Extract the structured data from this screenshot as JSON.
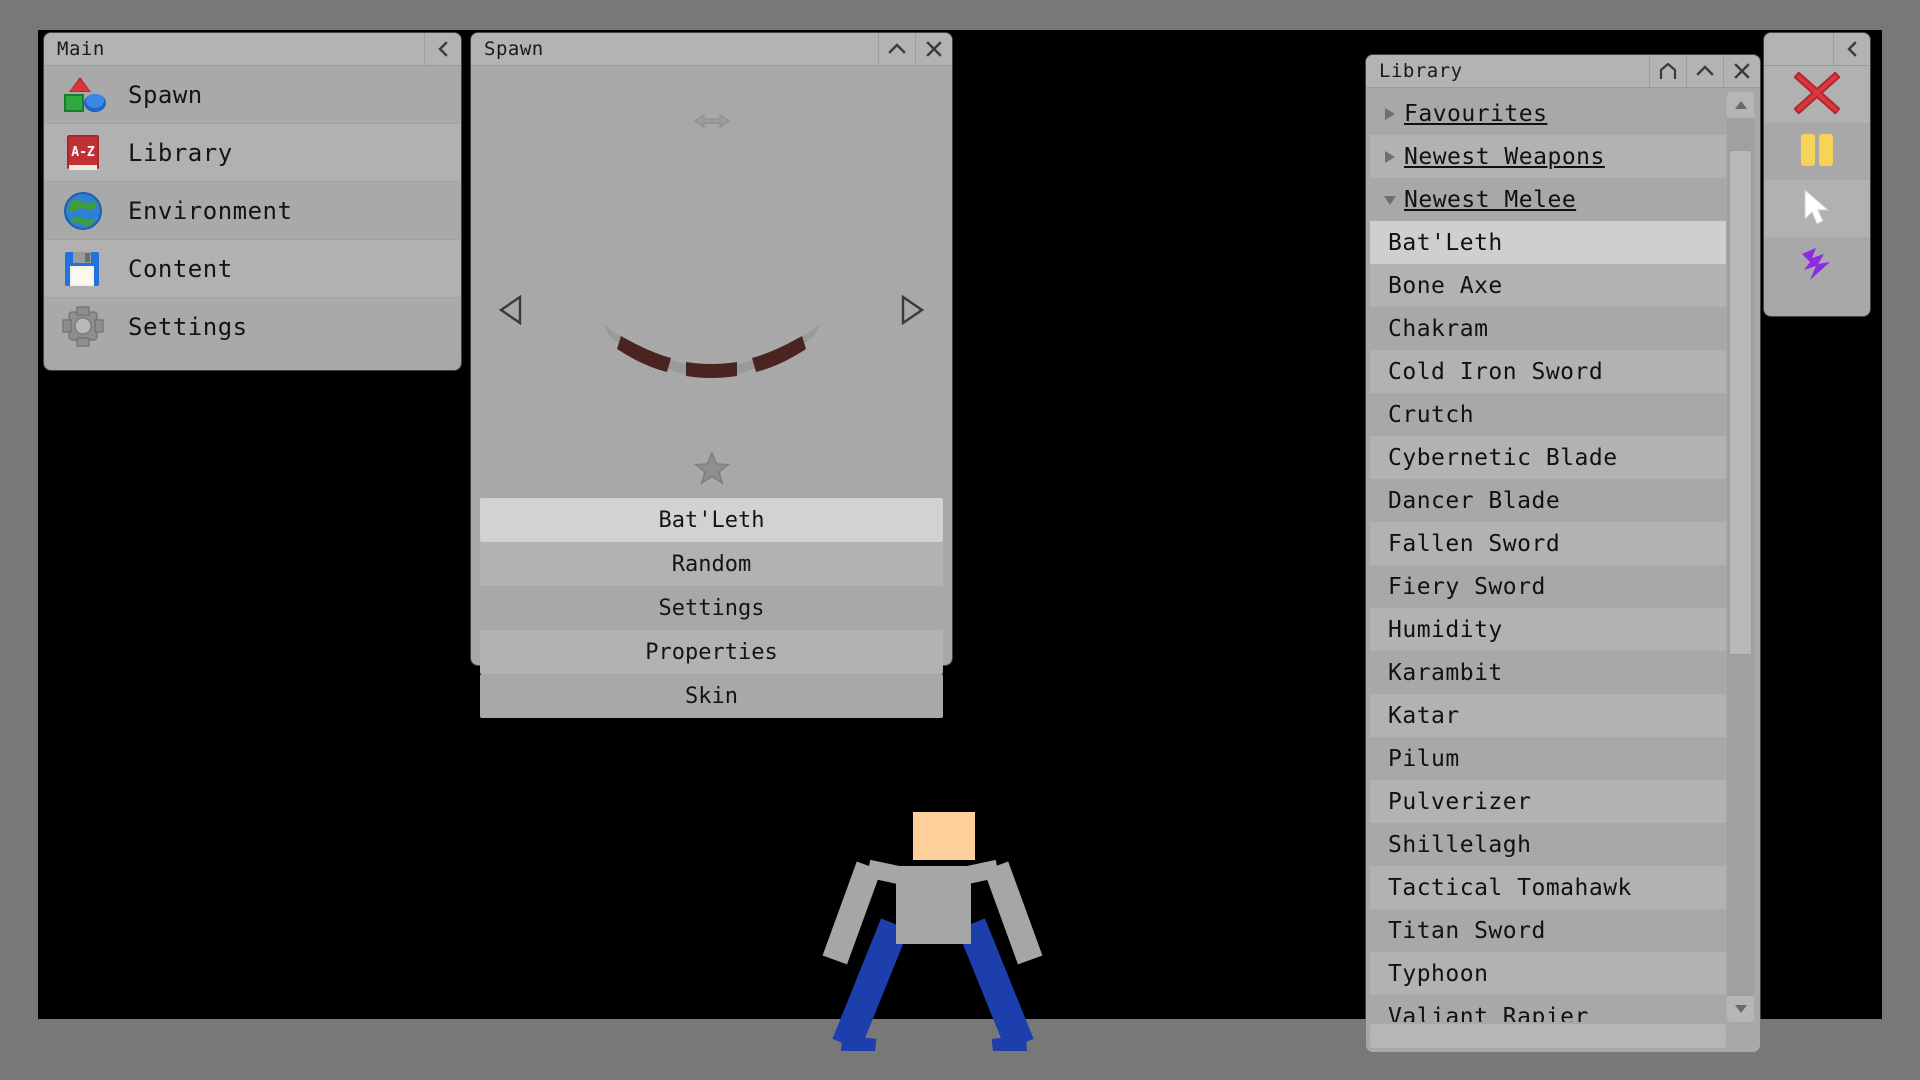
{
  "window_controls": {
    "collapse": "collapse-left-chevron",
    "minimize": "chevron-up",
    "close": "close-x",
    "home": "home"
  },
  "main_panel": {
    "title": "Main",
    "collapse_label": "<",
    "items": [
      {
        "label": "Spawn",
        "icon": "shapes-icon"
      },
      {
        "label": "Library",
        "icon": "book-a-z-icon"
      },
      {
        "label": "Environment",
        "icon": "globe-icon"
      },
      {
        "label": "Content",
        "icon": "floppy-disk-icon"
      },
      {
        "label": "Settings",
        "icon": "gear-icon"
      }
    ]
  },
  "spawn_panel": {
    "title": "Spawn",
    "minimize_label": "^",
    "close_label": "X",
    "move_handle": "horizontal-resize-arrows",
    "prev_label": "◁",
    "next_label": "▷",
    "favourite_icon": "star-icon",
    "preview_item": "Bat'Leth",
    "buttons": [
      {
        "label": "Bat'Leth",
        "state": "selected"
      },
      {
        "label": "Random",
        "state": "alt"
      },
      {
        "label": "Settings",
        "state": "base"
      },
      {
        "label": "Properties",
        "state": "alt"
      },
      {
        "label": "Skin",
        "state": "base"
      }
    ]
  },
  "library_panel": {
    "title": "Library",
    "home_label": "⌂",
    "minimize_label": "^",
    "close_label": "X",
    "groups": [
      {
        "label": "Favourites",
        "expanded": false
      },
      {
        "label": "Newest Weapons",
        "expanded": false
      },
      {
        "label": "Newest Melee",
        "expanded": true
      }
    ],
    "items": [
      "Bat'Leth",
      "Bone Axe",
      "Chakram",
      "Cold Iron Sword",
      "Crutch",
      "Cybernetic Blade",
      "Dancer Blade",
      "Fallen Sword",
      "Fiery Sword",
      "Humidity",
      "Karambit",
      "Katar",
      "Pilum",
      "Pulverizer",
      "Shillelagh",
      "Tactical Tomahawk",
      "Titan Sword",
      "Typhoon",
      "Valiant Rapier"
    ],
    "selected_item": "Bat'Leth",
    "scrollbar": {
      "up_label": "▲",
      "down_label": "▼"
    }
  },
  "tool_panel": {
    "collapse_label": "<",
    "tools": [
      {
        "name": "delete-tool",
        "icon": "red-x-icon",
        "color": "#b5252e"
      },
      {
        "name": "pause-tool",
        "icon": "yellow-pause-icon",
        "color": "#f8d35a"
      },
      {
        "name": "select-tool",
        "icon": "cursor-arrow-icon",
        "color": "#ffffff"
      },
      {
        "name": "lightning-tool",
        "icon": "purple-lightning-icon",
        "color": "#8b2be2"
      }
    ]
  },
  "scene": {
    "background_color": "#000000",
    "frame_color": "#787878",
    "ground_color": "#787878",
    "character": {
      "head_color": "#ffcf9b",
      "shirt_color": "#a6a6a6",
      "pants_color": "#1c3fad"
    },
    "weapon_preview": {
      "blade_color": "#a9a9a9",
      "grip_color": "#4a2420"
    }
  }
}
